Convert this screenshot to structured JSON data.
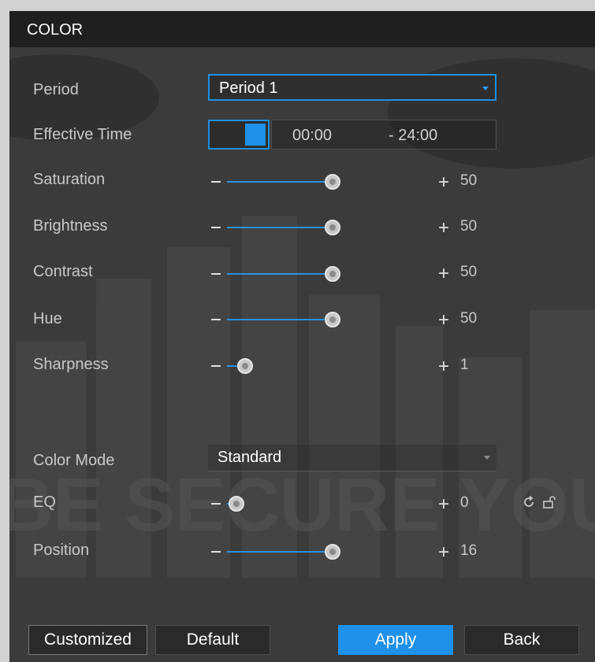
{
  "window": {
    "title": "COLOR"
  },
  "rows": {
    "period": {
      "label": "Period",
      "value": "Period 1"
    },
    "effective_time": {
      "label": "Effective Time",
      "enabled": true,
      "start": "00:00",
      "end": "- 24:00"
    },
    "saturation": {
      "label": "Saturation",
      "value": "50",
      "level": 0.5
    },
    "brightness": {
      "label": "Brightness",
      "value": "50",
      "level": 0.5
    },
    "contrast": {
      "label": "Contrast",
      "value": "50",
      "level": 0.5
    },
    "hue": {
      "label": "Hue",
      "value": "50",
      "level": 0.5
    },
    "sharpness": {
      "label": "Sharpness",
      "value": "1",
      "level": 0.1
    },
    "color_mode": {
      "label": "Color Mode",
      "value": "Standard"
    },
    "eq": {
      "label": "EQ",
      "value": "0",
      "level": 0.0
    },
    "position": {
      "label": "Position",
      "value": "16",
      "level": 0.5
    }
  },
  "slider_symbols": {
    "plus": "+"
  },
  "icons": {
    "reset": "refresh-icon",
    "lock": "unlock-icon"
  },
  "background": {
    "watermark_text": "BE SECURE YOUR LIFE"
  },
  "buttons": {
    "customized": "Customized",
    "default": "Default",
    "apply": "Apply",
    "back": "Back"
  },
  "colors": {
    "accent": "#1e90e8",
    "panel": "#3b3b3b",
    "titlebar": "#1f1f1f"
  }
}
